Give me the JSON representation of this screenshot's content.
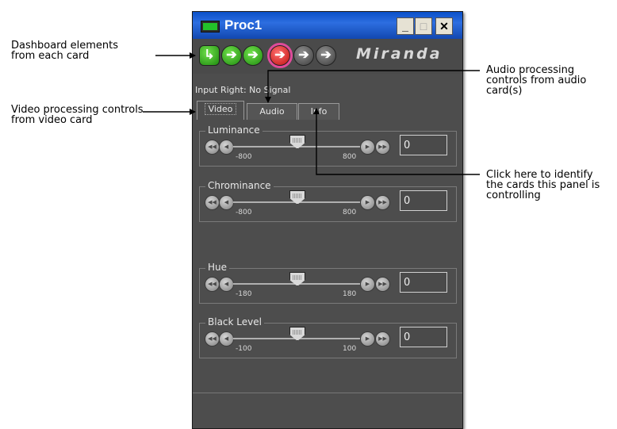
{
  "window": {
    "title": "Proc1",
    "controls": {
      "minimize": "_",
      "maximize": "□",
      "close": "✕"
    }
  },
  "dashboard": {
    "card_icons": [
      {
        "icon": "card-status-icon",
        "color": "green"
      },
      {
        "icon": "arrow-right-icon",
        "color": "green"
      },
      {
        "icon": "arrow-right-icon",
        "color": "green"
      },
      {
        "icon": "arrow-right-icon",
        "color": "red"
      },
      {
        "icon": "arrow-right-icon",
        "color": "gray"
      },
      {
        "icon": "arrow-right-icon",
        "color": "gray"
      }
    ],
    "logo": "Miranda"
  },
  "status": "Input Right: No Signal",
  "tabs": [
    {
      "label": "Video",
      "active": true
    },
    {
      "label": "Audio",
      "active": false
    },
    {
      "label": "Info",
      "active": false
    }
  ],
  "controls": [
    {
      "label": "Luminance",
      "min": "-800",
      "max": "800",
      "value": "0",
      "fraction": 0.5
    },
    {
      "label": "Chrominance",
      "min": "-800",
      "max": "800",
      "value": "0",
      "fraction": 0.5
    },
    {
      "label": "Hue",
      "min": "-180",
      "max": "180",
      "value": "0",
      "fraction": 0.5
    },
    {
      "label": "Black Level",
      "min": "-100",
      "max": "100",
      "value": "0",
      "fraction": 0.5
    }
  ],
  "callouts": {
    "dashboard": [
      "Dashboard elements",
      "from each card"
    ],
    "video": [
      "Video processing controls",
      "from video card"
    ],
    "audio": [
      "Audio processing",
      "controls from audio",
      "card(s)"
    ],
    "info": [
      "Click here to identify",
      "the cards this panel is",
      "controlling"
    ]
  },
  "colors": {
    "title_bar": "#1f5fd6",
    "panel_bg": "#4d4d4d",
    "status_green": "#23c12a",
    "status_red": "#d01818",
    "selection_outline": "#e04b9a"
  }
}
